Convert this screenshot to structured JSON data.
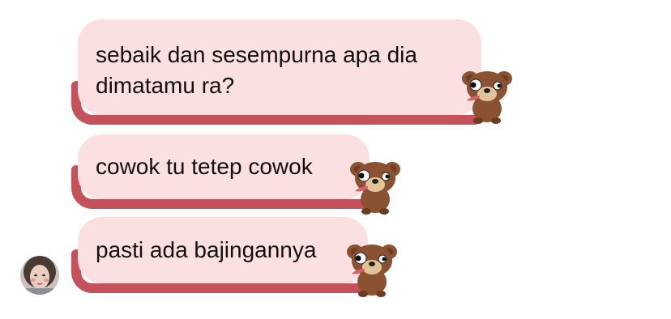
{
  "colors": {
    "bubble": "#fbe0e1",
    "tongue": "#c5515a",
    "bear_fur": "#8a5230",
    "bear_snout": "#e2c39a",
    "text": "#111111"
  },
  "messages": [
    {
      "text": "sebaik dan sesempurna apa dia\ndimatamu ra?",
      "sticker": "bear-peek-icon"
    },
    {
      "text": "cowok tu tetep cowok",
      "sticker": "bear-peek-icon"
    },
    {
      "text": "pasti ada bajingannya",
      "sticker": "bear-peek-icon"
    }
  ],
  "sender": {
    "avatar": "avatar-photo"
  }
}
